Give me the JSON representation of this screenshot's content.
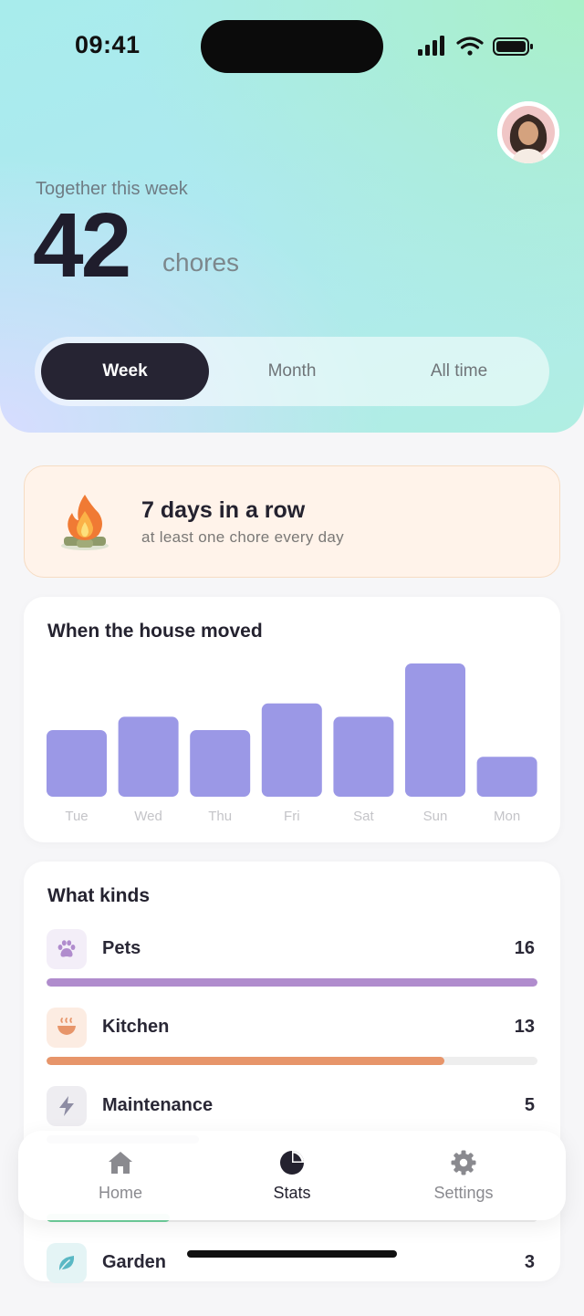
{
  "status_bar": {
    "time": "09:41"
  },
  "header": {
    "caption": "Together this week",
    "total": "42",
    "unit": "chores",
    "tabs": [
      {
        "label": "Week",
        "active": true
      },
      {
        "label": "Month",
        "active": false
      },
      {
        "label": "All time",
        "active": false
      }
    ]
  },
  "streak": {
    "icon": "campfire-icon",
    "title": "7 days in a row",
    "subtitle": "at least one chore every day"
  },
  "chart_data": {
    "type": "bar",
    "title": "When the house moved",
    "categories": [
      "Tue",
      "Wed",
      "Thu",
      "Fri",
      "Sat",
      "Sun",
      "Mon"
    ],
    "values": [
      5,
      6,
      5,
      7,
      6,
      10,
      3
    ],
    "ylim": [
      0,
      10
    ],
    "bar_color": "#9b98e6",
    "grid": false
  },
  "kinds": {
    "title": "What kinds",
    "items": [
      {
        "label": "Pets",
        "count": "16",
        "value": 16,
        "fraction": 1.0,
        "color": "#b08ccd",
        "icon_bg": "#f3eef8",
        "icon": "paw-icon"
      },
      {
        "label": "Kitchen",
        "count": "13",
        "value": 13,
        "fraction": 0.81,
        "color": "#e7956a",
        "icon_bg": "#fcece2",
        "icon": "bowl-icon"
      },
      {
        "label": "Maintenance",
        "count": "5",
        "value": 5,
        "fraction": 0.31,
        "color": "#8d8ca3",
        "icon_bg": "#eeedf1",
        "icon": "bolt-icon"
      },
      {
        "label": "",
        "count": "",
        "value": null,
        "fraction": 0.25,
        "color": "#6fcf9c",
        "icon_bg": "",
        "icon": ""
      },
      {
        "label": "Garden",
        "count": "3",
        "value": 3,
        "fraction": 0.19,
        "color": "#5ab8c4",
        "icon_bg": "#e4f4f5",
        "icon": "leaf-icon"
      }
    ]
  },
  "nav": {
    "items": [
      {
        "label": "Home",
        "icon": "home-icon",
        "active": false
      },
      {
        "label": "Stats",
        "icon": "pie-chart-icon",
        "active": true
      },
      {
        "label": "Settings",
        "icon": "gear-icon",
        "active": false
      }
    ]
  }
}
